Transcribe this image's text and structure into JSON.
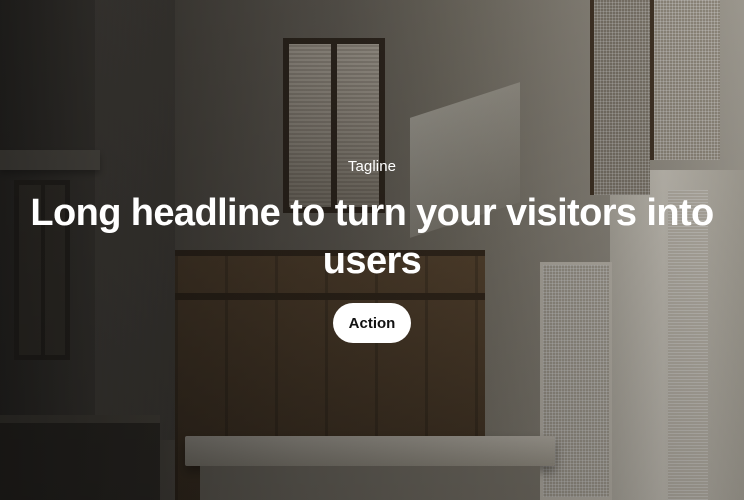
{
  "hero": {
    "tagline": "Tagline",
    "headline": "Long headline to turn your visitors into users",
    "action_label": "Action",
    "background_image": "architectural-interior-photo",
    "text_color": "#ffffff",
    "button_background": "#ffffff",
    "button_text_color": "#111111"
  }
}
